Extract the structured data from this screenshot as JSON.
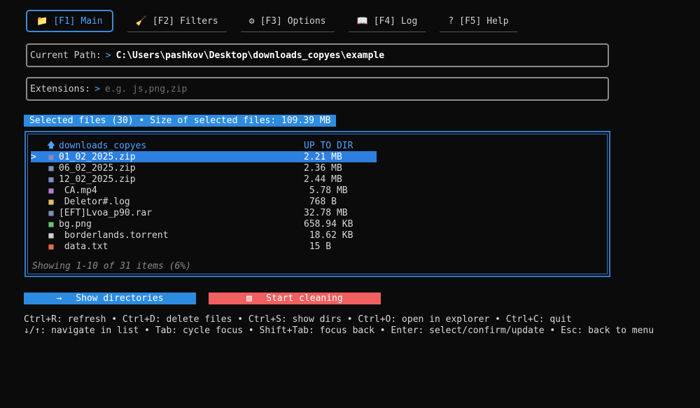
{
  "tabs": [
    {
      "icon": "📁",
      "icon_name": "folder-icon",
      "label": "[F1] Main",
      "active": true
    },
    {
      "icon": "🧹",
      "icon_name": "broom-icon",
      "label": "[F2] Filters"
    },
    {
      "icon": "⚙",
      "icon_name": "gear-icon",
      "label": "[F3] Options"
    },
    {
      "icon": "📖",
      "icon_name": "book-icon",
      "label": "[F4] Log"
    },
    {
      "icon": "?",
      "icon_name": "question-icon",
      "label": "[F5] Help"
    }
  ],
  "path": {
    "label": "Current Path:",
    "arrow": ">",
    "value": "C:\\Users\\pashkov\\Desktop\\downloads_copyes\\example"
  },
  "extensions": {
    "label": "Extensions:",
    "arrow": ">",
    "value": "",
    "placeholder": "e.g. js,png,zip"
  },
  "selection_info": "Selected files (30) • Size of selected files: 109.39 MB",
  "files": [
    {
      "cursor": "",
      "icon": "🡅",
      "icon_name": "up-arrow-icon",
      "name": "downloads_copyes",
      "size": "UP TO DIR",
      "parent": true
    },
    {
      "cursor": ">",
      "icon": "■",
      "icon_name": "archive-icon",
      "name": "01_02_2025.zip",
      "size": "2.21 MB",
      "selected": true
    },
    {
      "cursor": "",
      "icon": "■",
      "icon_name": "archive-icon",
      "name": "06_02_2025.zip",
      "size": "2.36 MB"
    },
    {
      "cursor": "",
      "icon": "■",
      "icon_name": "archive-icon",
      "name": "12_02_2025.zip",
      "size": "2.44 MB"
    },
    {
      "cursor": "",
      "icon": "■",
      "icon_name": "video-icon",
      "name": " CA.mp4",
      "size": " 5.78 MB"
    },
    {
      "cursor": "",
      "icon": "■",
      "icon_name": "log-file-icon",
      "name": " Deletor#.log",
      "size": " 768 B"
    },
    {
      "cursor": "",
      "icon": "■",
      "icon_name": "archive-icon",
      "name": "[EFT]Lvoa_p90.rar",
      "size": "32.78 MB"
    },
    {
      "cursor": "",
      "icon": "■",
      "icon_name": "image-icon",
      "name": "bg.png",
      "size": "658.94 KB"
    },
    {
      "cursor": "",
      "icon": "■",
      "icon_name": "file-icon",
      "name": " borderlands.torrent",
      "size": " 18.62 KB"
    },
    {
      "cursor": "",
      "icon": "■",
      "icon_name": "text-file-icon",
      "name": " data.txt",
      "size": " 15 B"
    }
  ],
  "showing": "Showing 1-10 of 31 items (6%)",
  "buttons": {
    "show_dirs": {
      "icon": "→",
      "label": "Show directories"
    },
    "start_clean": {
      "icon": "▨",
      "label": "Start cleaning"
    }
  },
  "help_lines": [
    "Ctrl+R: refresh • Ctrl+D: delete files • Ctrl+S: show dirs • Ctrl+O: open in explorer • Ctrl+C: quit",
    "↓/↑: navigate in list • Tab: cycle focus • Shift+Tab: focus back • Enter: select/confirm/update • Esc: back to menu"
  ],
  "colors": {
    "accent": "#2d8be0",
    "danger": "#f06060",
    "background": "#0b0b0b"
  }
}
